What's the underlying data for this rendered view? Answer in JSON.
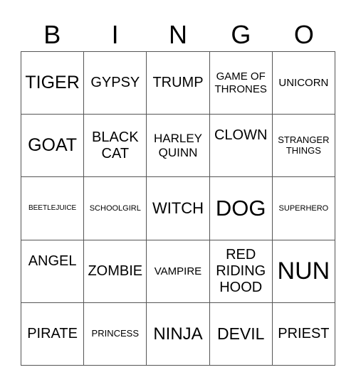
{
  "header": [
    "B",
    "I",
    "N",
    "G",
    "O"
  ],
  "rows": [
    [
      "TIGER",
      "GYPSY",
      "TRUMP",
      "GAME OF\nTHRONES",
      "UNICORN"
    ],
    [
      "GOAT",
      "BLACK\nCAT",
      "HARLEY\nQUINN",
      "CLOWN",
      "STRANGER\nTHINGS"
    ],
    [
      "BEETLEJUICE",
      "SCHOOLGIRL",
      "WITCH",
      "DOG",
      "SUPERHERO"
    ],
    [
      "ANGEL",
      "ZOMBIE",
      "VAMPIRE",
      "RED\nRIDING\nHOOD",
      "NUN"
    ],
    [
      "PIRATE",
      "PRINCESS",
      "NINJA",
      "DEVIL",
      "PRIEST"
    ]
  ]
}
